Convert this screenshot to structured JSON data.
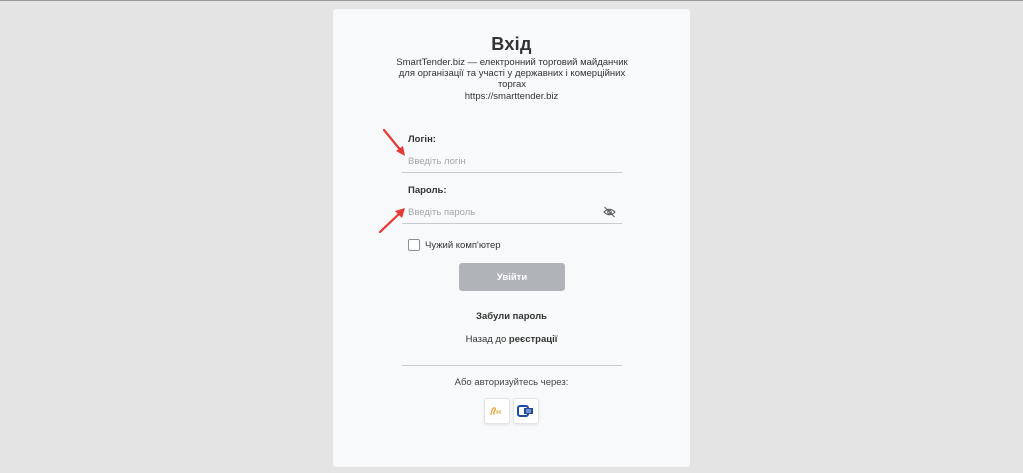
{
  "login_form": {
    "title": "Вхід",
    "description": "SmartTender.biz — електронний торговий майданчик для організації та участі у державних і комерційних торгах",
    "url": "https://smarttender.biz",
    "login_label": "Логін:",
    "login_placeholder": "Введіть логін",
    "password_label": "Пароль:",
    "password_placeholder": "Введіть пароль",
    "foreign_computer_label": "Чужий комп'ютер",
    "foreign_computer_checked": false,
    "submit_label": "Увійти",
    "forgot_password": "Забули пароль",
    "back_prefix": "Назад до ",
    "back_link": "реєстрації",
    "alt_auth_label": "Або авторизуйтесь через:",
    "providers": [
      {
        "icon": "key-signature-icon"
      },
      {
        "icon": "sign-provider-icon"
      }
    ]
  },
  "colors": {
    "background": "#e4e4e4",
    "card": "#f8f9fa",
    "button_disabled": "#b0b3b7",
    "annotation_arrow": "#e53935"
  }
}
